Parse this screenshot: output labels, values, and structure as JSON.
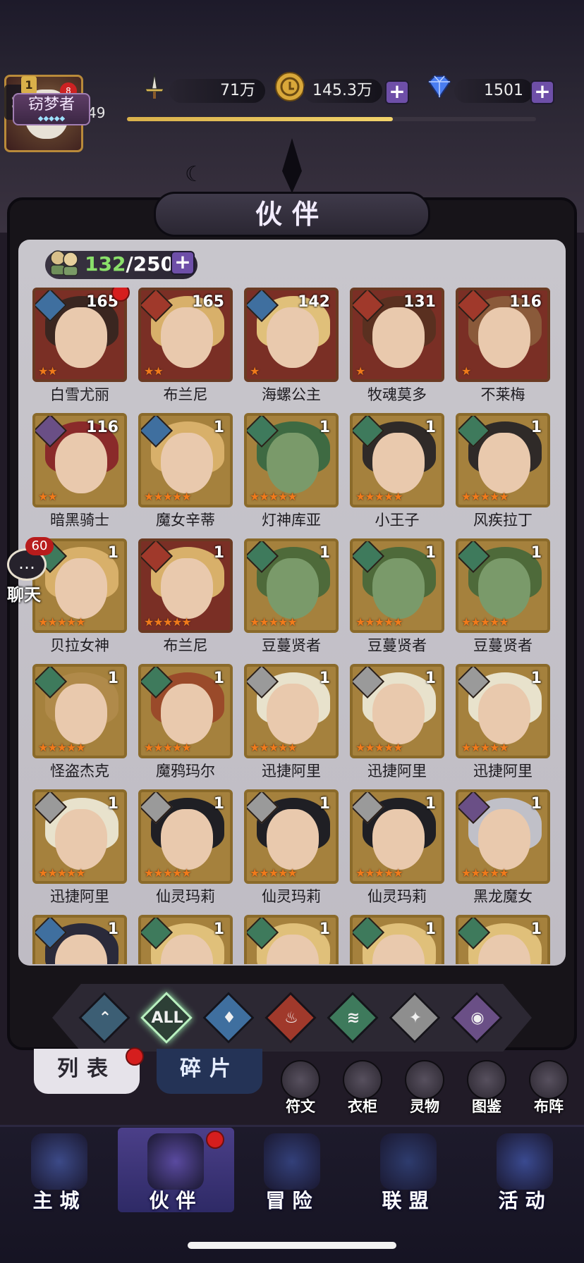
{
  "colors": {
    "accent_purple": "#6e4fa8",
    "roster_current": "#8ae06a",
    "star_orange": "#f07a1a",
    "notification_red": "#d51e1e"
  },
  "player": {
    "level": "49",
    "avatar_badge_level": "1",
    "title": "窃梦者",
    "xp_progress_percent": 65
  },
  "resources": {
    "power": "71万",
    "gold": "145.3万",
    "diamonds": "1501",
    "plus": "+"
  },
  "screen_title": "伙伴",
  "roster": {
    "current": "132",
    "max": "/250",
    "plus": "+"
  },
  "chat": {
    "label": "聊天",
    "count": "60",
    "glyph": "…"
  },
  "heroes": [
    {
      "name": "白雪尤丽",
      "level": "165",
      "stars": "★★",
      "element": "water",
      "new": true
    },
    {
      "name": "布兰尼",
      "level": "165",
      "stars": "★★",
      "element": "fire",
      "new": false
    },
    {
      "name": "海螺公主",
      "level": "142",
      "stars": "★",
      "element": "water",
      "new": false
    },
    {
      "name": "牧魂莫多",
      "level": "131",
      "stars": "★",
      "element": "fire",
      "new": false
    },
    {
      "name": "不莱梅",
      "level": "116",
      "stars": "★",
      "element": "fire",
      "new": false
    },
    {
      "name": "暗黑骑士",
      "level": "116",
      "stars": "★★",
      "element": "dark",
      "new": false
    },
    {
      "name": "魔女辛蒂",
      "level": "1",
      "stars": "★★★★★",
      "element": "water",
      "new": false
    },
    {
      "name": "灯神库亚",
      "level": "1",
      "stars": "★★★★★",
      "element": "wind",
      "new": false
    },
    {
      "name": "小王子",
      "level": "1",
      "stars": "★★★★★",
      "element": "wind",
      "new": false
    },
    {
      "name": "风疾拉丁",
      "level": "1",
      "stars": "★★★★★",
      "element": "wind",
      "new": false
    },
    {
      "name": "贝拉女神",
      "level": "1",
      "stars": "★★★★★",
      "element": "wind",
      "new": false
    },
    {
      "name": "布兰尼",
      "level": "1",
      "stars": "★★★★★",
      "element": "fire",
      "new": false
    },
    {
      "name": "豆蔓贤者",
      "level": "1",
      "stars": "★★★★★",
      "element": "wind",
      "new": false
    },
    {
      "name": "豆蔓贤者",
      "level": "1",
      "stars": "★★★★★",
      "element": "wind",
      "new": false
    },
    {
      "name": "豆蔓贤者",
      "level": "1",
      "stars": "★★★★★",
      "element": "wind",
      "new": false
    },
    {
      "name": "怪盗杰克",
      "level": "1",
      "stars": "★★★★★",
      "element": "wind",
      "new": false
    },
    {
      "name": "魔鸦玛尔",
      "level": "1",
      "stars": "★★★★★",
      "element": "wind",
      "new": false
    },
    {
      "name": "迅捷阿里",
      "level": "1",
      "stars": "★★★★★",
      "element": "light",
      "new": false
    },
    {
      "name": "迅捷阿里",
      "level": "1",
      "stars": "★★★★★",
      "element": "light",
      "new": false
    },
    {
      "name": "迅捷阿里",
      "level": "1",
      "stars": "★★★★★",
      "element": "light",
      "new": false
    },
    {
      "name": "迅捷阿里",
      "level": "1",
      "stars": "★★★★★",
      "element": "light",
      "new": false
    },
    {
      "name": "仙灵玛莉",
      "level": "1",
      "stars": "★★★★★",
      "element": "light",
      "new": false
    },
    {
      "name": "仙灵玛莉",
      "level": "1",
      "stars": "★★★★★",
      "element": "light",
      "new": false
    },
    {
      "name": "仙灵玛莉",
      "level": "1",
      "stars": "★★★★★",
      "element": "light",
      "new": false
    },
    {
      "name": "黑龙魔女",
      "level": "1",
      "stars": "★★★★★",
      "element": "dark",
      "new": false
    },
    {
      "name": "",
      "level": "1",
      "stars": "",
      "element": "water",
      "new": false
    },
    {
      "name": "",
      "level": "1",
      "stars": "",
      "element": "wind",
      "new": false
    },
    {
      "name": "",
      "level": "1",
      "stars": "",
      "element": "wind",
      "new": false
    },
    {
      "name": "",
      "level": "1",
      "stars": "",
      "element": "wind",
      "new": false
    },
    {
      "name": "",
      "level": "1",
      "stars": "",
      "element": "wind",
      "new": false
    }
  ],
  "element_colors": {
    "water": "#3f6f9f",
    "fire": "#a0392b",
    "wind": "#3e7a5c",
    "light": "#9a9a9a",
    "dark": "#6a4f86",
    "all": "#2d3f36"
  },
  "filters": [
    {
      "name": "mage",
      "glyph": "⌃",
      "color": "#3c5e74",
      "active": false
    },
    {
      "name": "all",
      "glyph": "ALL",
      "color": "#2d3f36",
      "active": true
    },
    {
      "name": "water",
      "glyph": "♦",
      "color": "#3f6f9f",
      "active": false
    },
    {
      "name": "fire",
      "glyph": "♨",
      "color": "#a0392b",
      "active": false
    },
    {
      "name": "wind",
      "glyph": "≋",
      "color": "#3e7a5c",
      "active": false
    },
    {
      "name": "light",
      "glyph": "✦",
      "color": "#8e8e8e",
      "active": false
    },
    {
      "name": "dark",
      "glyph": "◉",
      "color": "#6a4f86",
      "active": false
    }
  ],
  "tabs": {
    "list": "列表",
    "fragments": "碎片"
  },
  "tools": [
    {
      "label": "符文",
      "icon": "rune-anvil-icon"
    },
    {
      "label": "衣柜",
      "icon": "wardrobe-icon"
    },
    {
      "label": "灵物",
      "icon": "spirit-lamp-icon"
    },
    {
      "label": "图鉴",
      "icon": "codex-cards-icon"
    },
    {
      "label": "布阵",
      "icon": "formation-icon"
    }
  ],
  "nav": [
    {
      "label": "主城",
      "icon": "castle-icon",
      "color": "#3c4a88",
      "active": false
    },
    {
      "label": "伙伴",
      "icon": "witch-hat-icon",
      "color": "#5a4aa0",
      "active": true
    },
    {
      "label": "冒险",
      "icon": "compass-icon",
      "color": "#33407a",
      "active": false
    },
    {
      "label": "联盟",
      "icon": "shield-icon",
      "color": "#2e3c6e",
      "active": false
    },
    {
      "label": "活动",
      "icon": "cards-icon",
      "color": "#3a4a90",
      "active": false
    }
  ]
}
